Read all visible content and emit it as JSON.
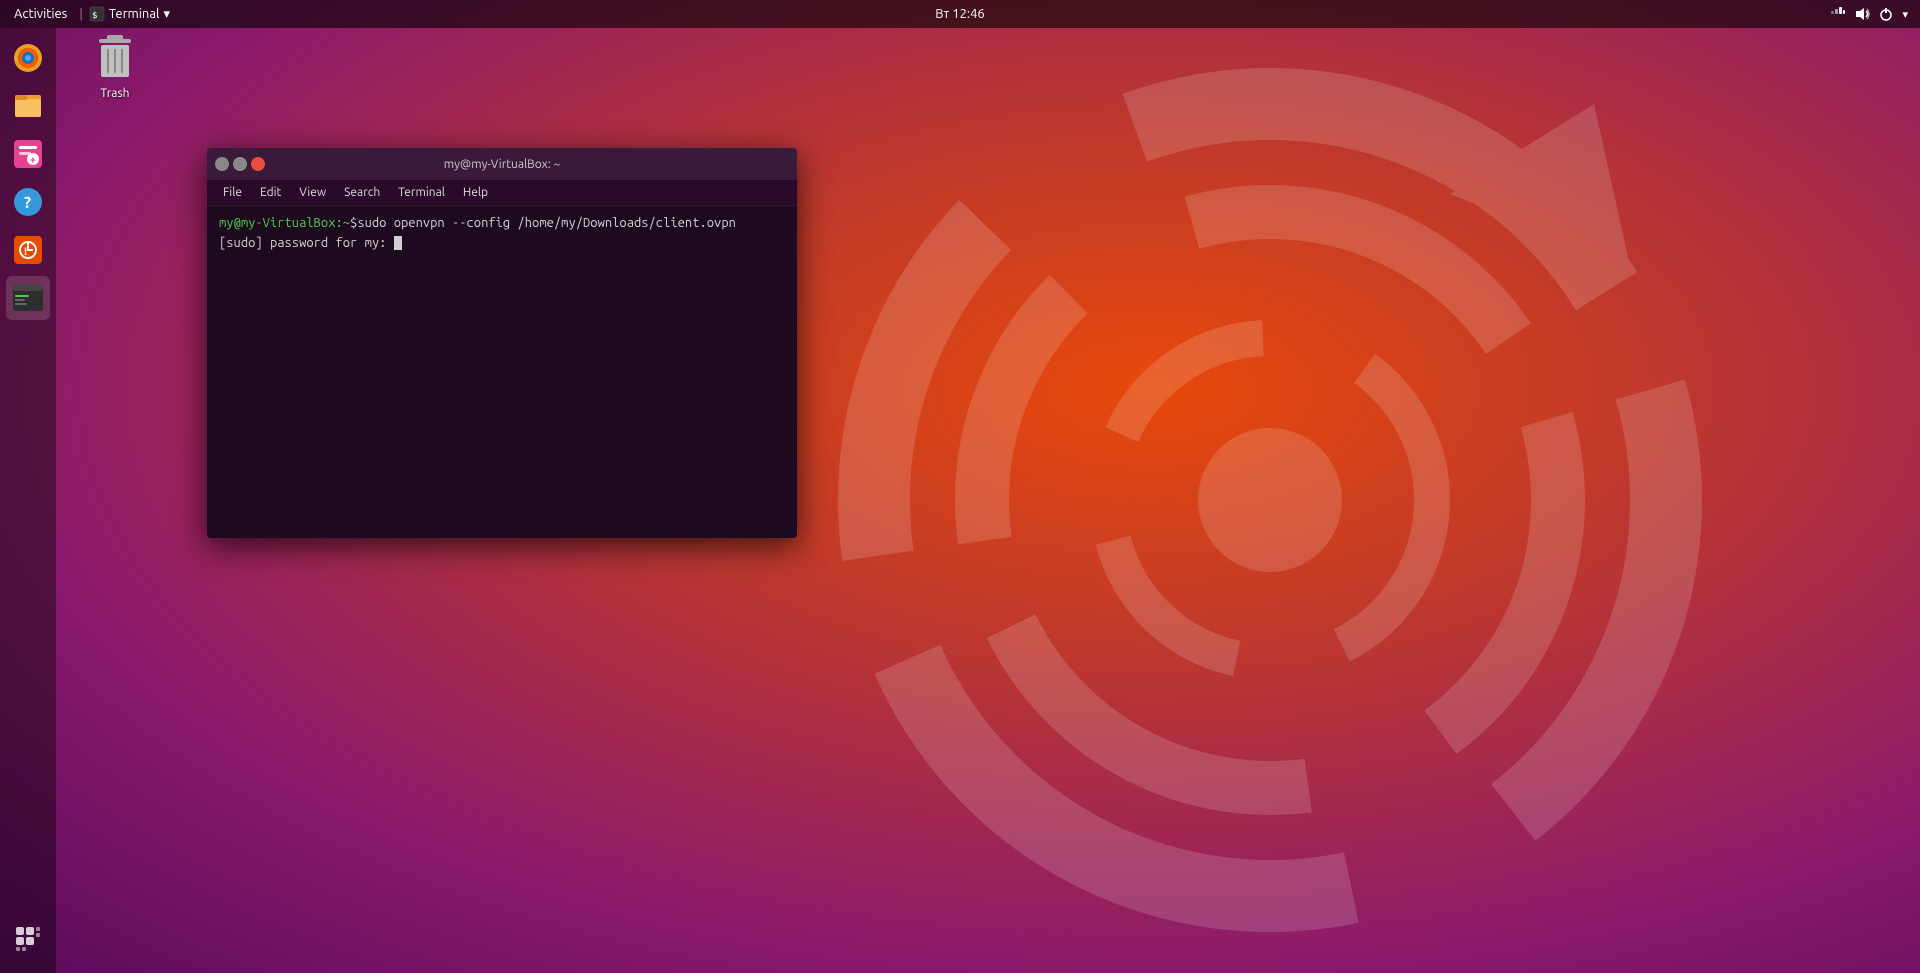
{
  "topbar": {
    "activities_label": "Activities",
    "terminal_label": "Terminal",
    "terminal_dropdown": "▾",
    "clock": "Вт 12:46",
    "tray": {
      "network_icon": "⊞",
      "audio_icon": "🔊",
      "power_icon": "⏻",
      "dropdown_icon": "▾"
    }
  },
  "desktop": {
    "trash_label": "Trash"
  },
  "dock": {
    "items": [
      {
        "name": "firefox",
        "label": "Firefox"
      },
      {
        "name": "files",
        "label": "Files"
      },
      {
        "name": "software",
        "label": "Software"
      },
      {
        "name": "help",
        "label": "Help"
      },
      {
        "name": "updates",
        "label": "Updates"
      },
      {
        "name": "terminal",
        "label": "Terminal"
      }
    ]
  },
  "terminal": {
    "title": "my@my-VirtualBox: ~",
    "menu": [
      "File",
      "Edit",
      "View",
      "Search",
      "Terminal",
      "Help"
    ],
    "prompt_user": "my@my-VirtualBox",
    "prompt_path": ":~",
    "prompt_symbol": "$",
    "command": " sudo openvpn --config /home/my/Downloads/client.ovpn",
    "output_line1": "[sudo] password for my:"
  },
  "window_buttons": {
    "minimize": "–",
    "maximize": "□",
    "close": "×"
  }
}
